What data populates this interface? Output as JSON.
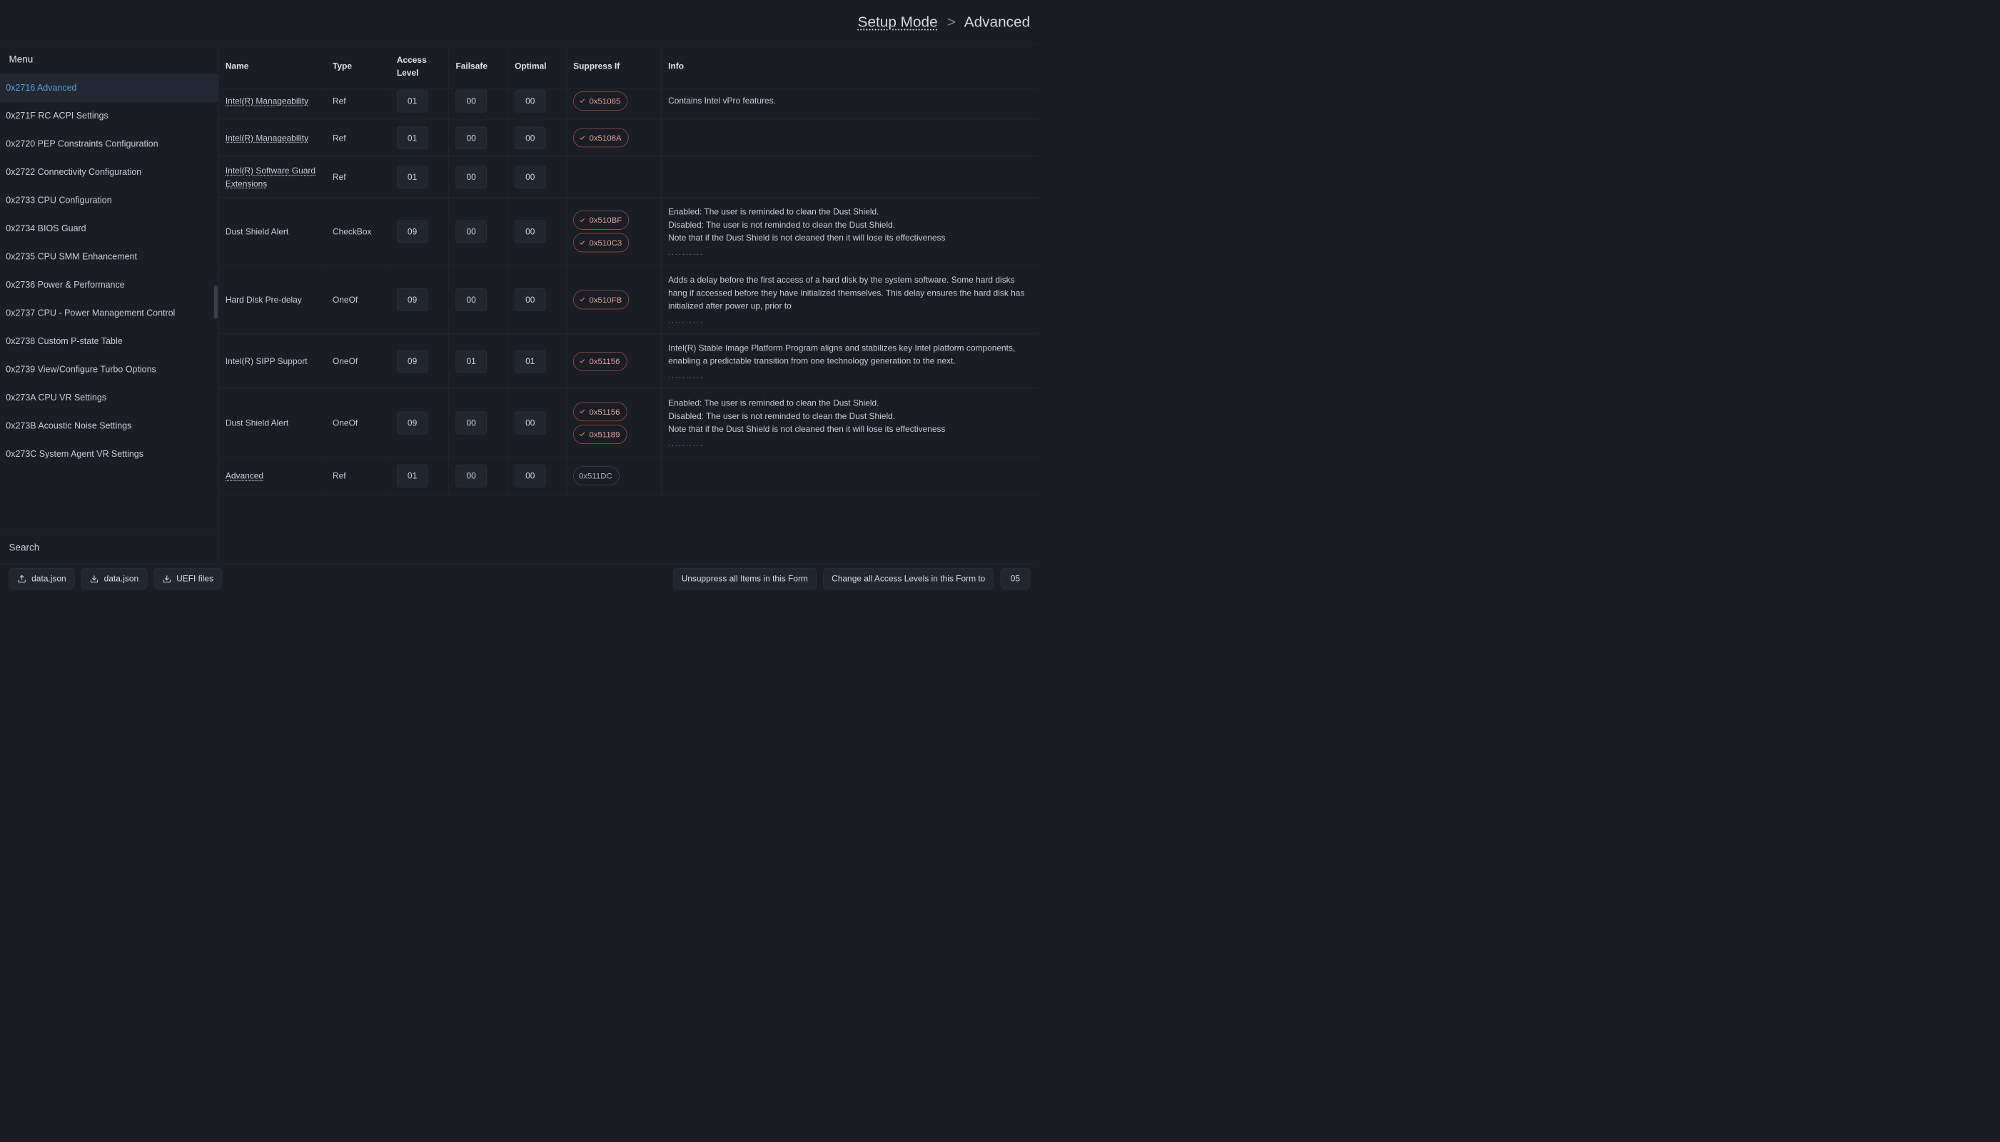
{
  "breadcrumb": {
    "root": "Setup Mode",
    "sep": ">",
    "current": "Advanced"
  },
  "sidebar": {
    "title": "Menu",
    "items": [
      {
        "label": "0x2716 Advanced",
        "active": true
      },
      {
        "label": "0x271F RC ACPI Settings"
      },
      {
        "label": "0x2720 PEP Constraints Configuration"
      },
      {
        "label": "0x2722 Connectivity Configuration"
      },
      {
        "label": "0x2733 CPU Configuration"
      },
      {
        "label": "0x2734 BIOS Guard"
      },
      {
        "label": "0x2735 CPU SMM Enhancement"
      },
      {
        "label": "0x2736 Power & Performance"
      },
      {
        "label": "0x2737 CPU - Power Management Control"
      },
      {
        "label": "0x2738 Custom P-state Table"
      },
      {
        "label": "0x2739 View/Configure Turbo Options"
      },
      {
        "label": "0x273A CPU VR Settings"
      },
      {
        "label": "0x273B Acoustic Noise Settings"
      },
      {
        "label": "0x273C System Agent VR Settings"
      }
    ],
    "search": "Search"
  },
  "columns": {
    "name": "Name",
    "type": "Type",
    "access": "Access Level",
    "failsafe": "Failsafe",
    "optimal": "Optimal",
    "suppress": "Suppress If",
    "info": "Info"
  },
  "rows": [
    {
      "name": "Intel(R) Manageability",
      "link": true,
      "cut": true,
      "type": "Ref",
      "access": "01",
      "failsafe": "00",
      "optimal": "00",
      "suppress": [
        {
          "label": "0x51065",
          "red": true
        }
      ],
      "info": "Contains Intel vPro features."
    },
    {
      "name": "Intel(R) Manageability",
      "link": true,
      "type": "Ref",
      "access": "01",
      "failsafe": "00",
      "optimal": "00",
      "suppress": [
        {
          "label": "0x5108A",
          "red": true
        }
      ],
      "info": ""
    },
    {
      "name": "Intel(R) Software Guard Extensions",
      "link": true,
      "type": "Ref",
      "access": "01",
      "failsafe": "00",
      "optimal": "00",
      "suppress": [],
      "info": ""
    },
    {
      "name": "Dust Shield Alert",
      "type": "CheckBox",
      "access": "09",
      "failsafe": "00",
      "optimal": "00",
      "suppress": [
        {
          "label": "0x510BF",
          "red": true
        },
        {
          "label": "0x510C3",
          "red": true
        }
      ],
      "info": "Enabled: The user is reminded to clean the Dust Shield.\nDisabled: The user is not reminded to clean the Dust Shield.\nNote that if the Dust Shield is not cleaned then it will lose its effectiveness",
      "more": true
    },
    {
      "name": "Hard Disk Pre-delay",
      "type": "OneOf",
      "access": "09",
      "failsafe": "00",
      "optimal": "00",
      "suppress": [
        {
          "label": "0x510FB",
          "red": true
        }
      ],
      "info": "Adds a delay before the first access of a hard disk by the system software. Some hard disks hang if accessed before they have initialized themselves. This delay ensures the hard disk has initialized after power up, prior to",
      "more": true
    },
    {
      "name": "Intel(R) SIPP Support",
      "type": "OneOf",
      "access": "09",
      "failsafe": "01",
      "optimal": "01",
      "suppress": [
        {
          "label": "0x51156",
          "red": true
        }
      ],
      "info": "Intel(R) Stable Image Platform Program aligns and stabilizes key Intel platform components, enabling a predictable transition from one technology generation to the next.",
      "more": true
    },
    {
      "name": "Dust Shield Alert",
      "type": "OneOf",
      "access": "09",
      "failsafe": "00",
      "optimal": "00",
      "suppress": [
        {
          "label": "0x51156",
          "red": true
        },
        {
          "label": "0x51189",
          "red": true
        }
      ],
      "info": "Enabled: The user is reminded to clean the Dust Shield.\nDisabled: The user is not reminded to clean the Dust Shield.\nNote that if the Dust Shield is not cleaned then it will lose its effectiveness",
      "more": true
    },
    {
      "name": "Advanced",
      "link": true,
      "type": "Ref",
      "access": "01",
      "failsafe": "00",
      "optimal": "00",
      "suppress": [
        {
          "label": "0x511DC",
          "red": false
        }
      ],
      "info": ""
    }
  ],
  "footer": {
    "upload": "data.json",
    "download": "data.json",
    "uefi": "UEFI files",
    "unsuppress": "Unsuppress all Items in this Form",
    "change_access": "Change all Access Levels in this Form to",
    "access_value": "05"
  }
}
